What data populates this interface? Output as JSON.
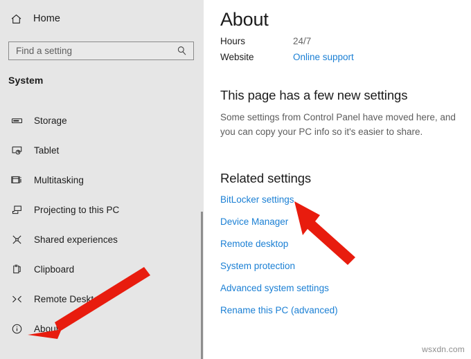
{
  "sidebar": {
    "home": {
      "label": "Home",
      "icon": "home-icon"
    },
    "search": {
      "placeholder": "Find a setting",
      "value": "",
      "icon": "search-icon"
    },
    "section_title": "System",
    "items": [
      {
        "label": "Storage",
        "icon": "storage-icon"
      },
      {
        "label": "Tablet",
        "icon": "tablet-icon"
      },
      {
        "label": "Multitasking",
        "icon": "multitasking-icon"
      },
      {
        "label": "Projecting to this PC",
        "icon": "projecting-icon"
      },
      {
        "label": "Shared experiences",
        "icon": "shared-experiences-icon"
      },
      {
        "label": "Clipboard",
        "icon": "clipboard-icon"
      },
      {
        "label": "Remote Desktop",
        "icon": "remote-desktop-icon"
      },
      {
        "label": "About",
        "icon": "info-icon"
      }
    ]
  },
  "content": {
    "page_title": "About",
    "info_rows": [
      {
        "key": "Hours",
        "value": "24/7",
        "is_link": false
      },
      {
        "key": "Website",
        "value": "Online support",
        "is_link": true
      }
    ],
    "new_settings": {
      "heading": "This page has a few new settings",
      "body": "Some settings from Control Panel have moved here, and you can copy your PC info so it's easier to share."
    },
    "related": {
      "heading": "Related settings",
      "links": [
        "BitLocker settings",
        "Device Manager",
        "Remote desktop",
        "System protection",
        "Advanced system settings",
        "Rename this PC (advanced)"
      ]
    }
  },
  "annotations": {
    "arrow_color": "#e81c0e",
    "arrows": [
      {
        "name": "arrow-to-bitlocker-settings",
        "points_to": "BitLocker settings"
      },
      {
        "name": "arrow-to-about",
        "points_to": "About"
      }
    ]
  },
  "watermark": "wsxdn.com",
  "colors": {
    "sidebar_bg": "#e6e6e6",
    "content_bg": "#ffffff",
    "link": "#1a7fd4",
    "text": "#1b1b1b",
    "muted_text": "#666666",
    "accent_red": "#e81c0e"
  }
}
